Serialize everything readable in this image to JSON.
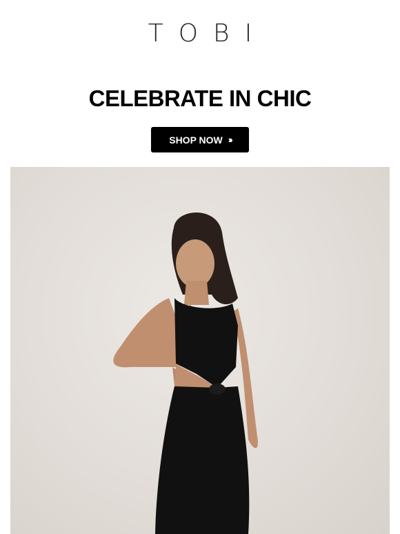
{
  "header": {
    "logo_text": "TOBI"
  },
  "hero": {
    "headline": "CELEBRATE IN CHIC",
    "cta_label": "SHOP NOW",
    "cta_arrows": "›››"
  },
  "colors": {
    "background": "#ffffff",
    "button_bg": "#000000",
    "button_text": "#ffffff",
    "photo_backdrop": "#e4dfda",
    "dress": "#111111"
  }
}
